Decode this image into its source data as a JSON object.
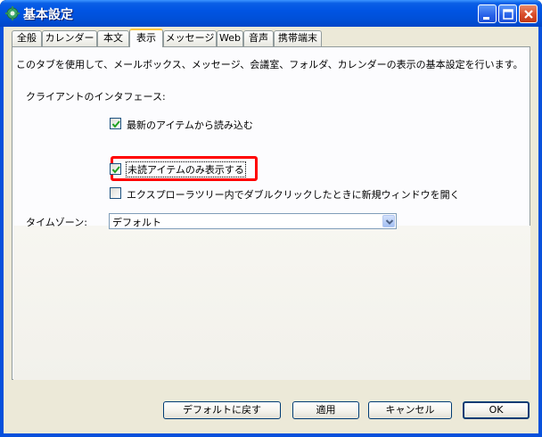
{
  "window": {
    "title": "基本設定",
    "title_icon": "settings-app-icon"
  },
  "tabs": [
    {
      "label": "全般",
      "active": false
    },
    {
      "label": "カレンダー",
      "active": false
    },
    {
      "label": "本文",
      "active": false
    },
    {
      "label": "表示",
      "active": true
    },
    {
      "label": "メッセージ",
      "active": false
    },
    {
      "label": "Web",
      "active": false
    },
    {
      "label": "音声",
      "active": false
    },
    {
      "label": "携帯端末",
      "active": false
    }
  ],
  "panel": {
    "description": "このタブを使用して、メールボックス、メッセージ、会議室、フォルダ、カレンダーの表示の基本設定を行います。",
    "section_label": "クライアントのインタフェース:",
    "options": [
      {
        "label": "最新のアイテムから読み込む",
        "checked": true
      },
      {
        "label": "未読アイテムのみ表示する",
        "checked": true,
        "highlighted": true
      },
      {
        "label": "エクスプローラツリー内でダブルクリックしたときに新規ウィンドウを開く",
        "checked": false
      }
    ],
    "timezone": {
      "label": "タイムゾーン:",
      "value": "デフォルト"
    }
  },
  "buttons": {
    "reset": "デフォルトに戻す",
    "apply": "適用",
    "cancel": "キャンセル",
    "ok": "OK"
  },
  "colors": {
    "titlebar": "#0054e3",
    "highlight": "#ff0000",
    "active_tab_accent": "#ffc83c",
    "dialog_bg": "#ece9d8"
  }
}
